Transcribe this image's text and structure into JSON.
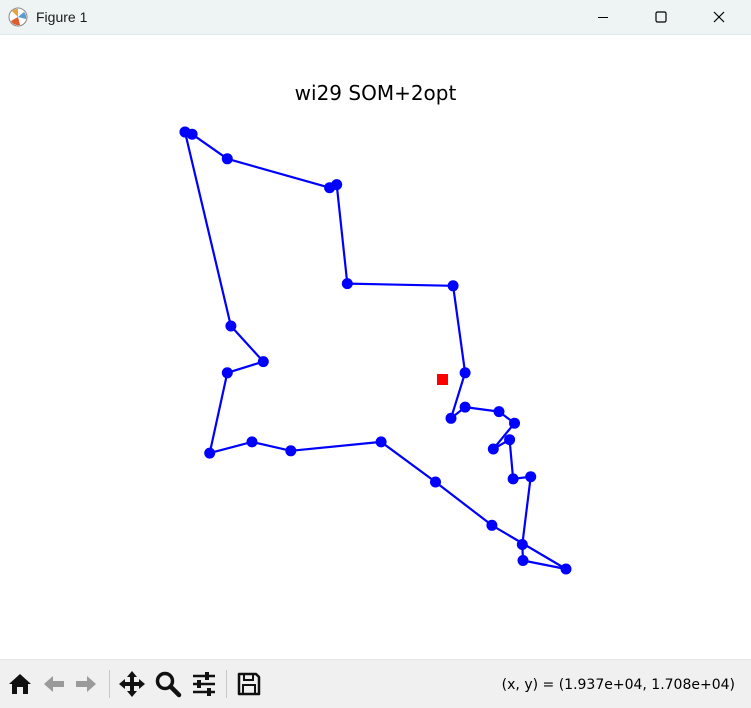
{
  "window": {
    "title": "Figure 1",
    "icons": [
      "matplotlib-app-icon",
      "minimize-icon",
      "maximize-icon",
      "close-icon"
    ]
  },
  "plot": {
    "title": "wi29 SOM+2opt",
    "line_color": "#0000ff",
    "start_marker_color": "#ff0000"
  },
  "chart_data": {
    "type": "line",
    "title": "wi29 SOM+2opt",
    "xlabel": "",
    "ylabel": "",
    "axes_visible": false,
    "grid": false,
    "series": [
      {
        "points": [
          [
            21450,
            22450
          ],
          [
            21550,
            22400
          ],
          [
            22050,
            21850
          ],
          [
            23500,
            21200
          ],
          [
            23600,
            21270
          ],
          [
            23750,
            19050
          ],
          [
            25250,
            19000
          ],
          [
            25420,
            17050
          ],
          [
            25220,
            16030
          ],
          [
            25420,
            16280
          ],
          [
            25900,
            16180
          ],
          [
            26120,
            15920
          ],
          [
            25820,
            15340
          ],
          [
            26050,
            15550
          ],
          [
            26100,
            14670
          ],
          [
            26350,
            14720
          ],
          [
            26230,
            13200
          ],
          [
            26240,
            12840
          ],
          [
            26850,
            12650
          ],
          [
            25800,
            13630
          ],
          [
            25000,
            14600
          ],
          [
            24230,
            15500
          ],
          [
            22950,
            15300
          ],
          [
            22400,
            15500
          ],
          [
            21800,
            15250
          ],
          [
            22050,
            17050
          ],
          [
            22560,
            17300
          ],
          [
            22100,
            18100
          ],
          [
            21450,
            22450
          ]
        ]
      }
    ],
    "start_point": [
      25100,
      16900
    ]
  },
  "toolbar": {
    "buttons": [
      "home-icon",
      "back-icon",
      "forward-icon",
      "pan-icon",
      "zoom-icon",
      "configure-subplots-icon",
      "save-icon"
    ],
    "coords_text": "(x, y) = (1.937e+04, 1.708e+04)"
  }
}
